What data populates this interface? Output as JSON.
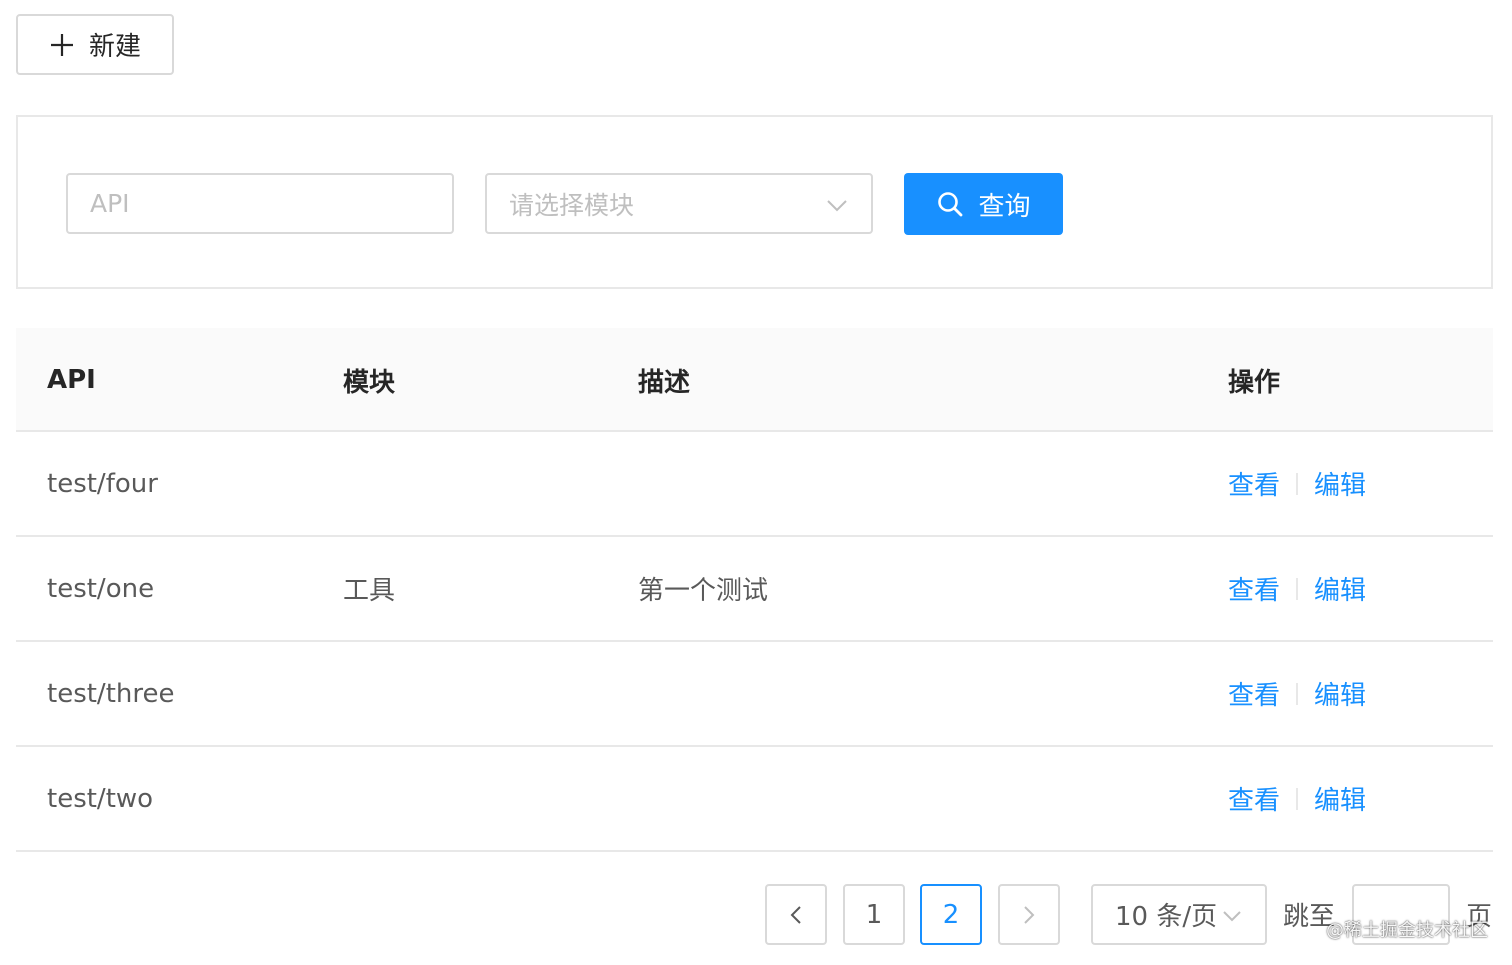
{
  "toolbar": {
    "new_label": "新建"
  },
  "search": {
    "api_placeholder": "API",
    "module_placeholder": "请选择模块",
    "query_label": "查询"
  },
  "table": {
    "headers": {
      "api": "API",
      "module": "模块",
      "description": "描述",
      "actions": "操作"
    },
    "rows": [
      {
        "api": "test/four",
        "module": "",
        "description": "",
        "view": "查看",
        "edit": "编辑"
      },
      {
        "api": "test/one",
        "module": "工具",
        "description": "第一个测试",
        "view": "查看",
        "edit": "编辑"
      },
      {
        "api": "test/three",
        "module": "",
        "description": "",
        "view": "查看",
        "edit": "编辑"
      },
      {
        "api": "test/two",
        "module": "",
        "description": "",
        "view": "查看",
        "edit": "编辑"
      }
    ]
  },
  "pagination": {
    "pages": [
      "1",
      "2"
    ],
    "current_page": "2",
    "page_size": "10 条/页",
    "jump_label": "跳至",
    "page_suffix": "页"
  },
  "watermark": "@稀土掘金技术社区",
  "colors": {
    "primary": "#1890ff",
    "border": "#d9d9d9",
    "header_bg": "#fafafa"
  }
}
